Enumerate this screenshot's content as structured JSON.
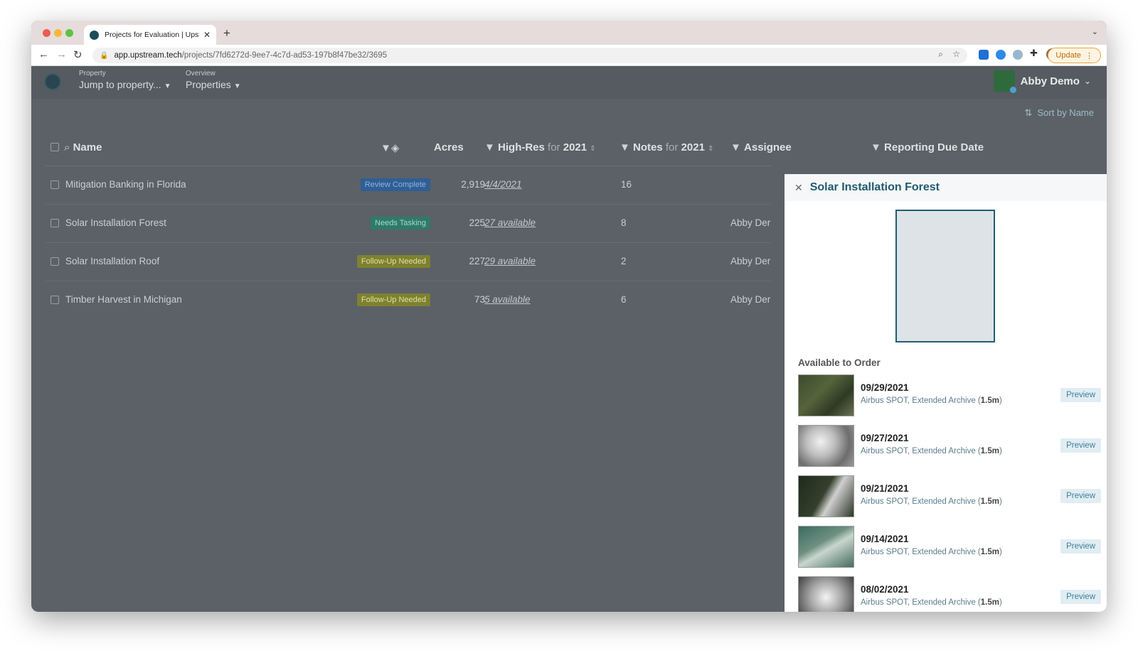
{
  "browser": {
    "tab_title": "Projects for Evaluation | Upstre",
    "url_host": "app.upstream.tech",
    "url_path": "/projects/7fd6272d-9ee7-4c7d-ad53-197b8f47be32/3695",
    "update_label": "Update"
  },
  "header": {
    "property_small": "Property",
    "property_main": "Jump to property...",
    "overview_small": "Overview",
    "overview_main": "Properties",
    "user_name": "Abby Demo"
  },
  "toolbar": {
    "sort_label": "Sort by Name"
  },
  "columns": {
    "name": "Name",
    "acres": "Acres",
    "highres": "High-Res",
    "highres_for": "for",
    "highres_year": "2021",
    "notes": "Notes",
    "notes_for": "for",
    "notes_year": "2021",
    "assignee": "Assignee",
    "due": "Reporting Due Date"
  },
  "rows": [
    {
      "name": "Mitigation Banking in Florida",
      "badge": "Review Complete",
      "badge_bg": "#2f5f95",
      "badge_fg": "#8fb2da",
      "acres": "2,919",
      "highres": "4/4/2021",
      "notes": "16",
      "assignee": ""
    },
    {
      "name": "Solar Installation Forest",
      "badge": "Needs Tasking",
      "badge_bg": "#2f7a6c",
      "badge_fg": "#a7d7cc",
      "acres": "225",
      "highres": "27 available",
      "notes": "8",
      "assignee": "Abby Der"
    },
    {
      "name": "Solar Installation Roof",
      "badge": "Follow-Up Needed",
      "badge_bg": "#7e8130",
      "badge_fg": "#dfe0a6",
      "acres": "227",
      "highres": "29 available",
      "notes": "2",
      "assignee": "Abby Der"
    },
    {
      "name": "Timber Harvest in Michigan",
      "badge": "Follow-Up Needed",
      "badge_bg": "#7e8130",
      "badge_fg": "#dfe0a6",
      "acres": "73",
      "highres": "5 available",
      "notes": "6",
      "assignee": "Abby Der"
    }
  ],
  "panel": {
    "title": "Solar Installation Forest",
    "available_label": "Available to Order",
    "images": [
      {
        "date": "09/29/2021",
        "source": "Airbus SPOT, Extended Archive (",
        "res": "1.5m",
        "close": ")",
        "preview": "Preview",
        "thumb": "linear-gradient(135deg,#3d4a2e 0%,#55643b 40%,#2e3a24 70%,#6a7050 100%)"
      },
      {
        "date": "09/27/2021",
        "source": "Airbus SPOT, Extended Archive (",
        "res": "1.5m",
        "close": ")",
        "preview": "Preview",
        "thumb": "radial-gradient(circle at 40% 40%,#f1f1f1 0%,#bdbdbd 35%,#6d6d6d 70%,#9a9a9a 100%)"
      },
      {
        "date": "09/21/2021",
        "source": "Airbus SPOT, Extended Archive (",
        "res": "1.5m",
        "close": ")",
        "preview": "Preview",
        "thumb": "linear-gradient(120deg,#1f2a1d 0%,#34402c 45%,#cfcfcf 60%,#2c3527 100%)"
      },
      {
        "date": "09/14/2021",
        "source": "Airbus SPOT, Extended Archive (",
        "res": "1.5m",
        "close": ")",
        "preview": "Preview",
        "thumb": "linear-gradient(150deg,#3b6b62 0%,#6d8f80 40%,#c9d6d0 55%,#456c5c 100%)"
      },
      {
        "date": "08/02/2021",
        "source": "Airbus SPOT, Extended Archive (",
        "res": "1.5m",
        "close": ")",
        "preview": "Preview",
        "thumb": "radial-gradient(circle at 50% 50%,#f4f4f4 0%,#a9a9a9 45%,#3f3f3f 100%)"
      }
    ]
  }
}
